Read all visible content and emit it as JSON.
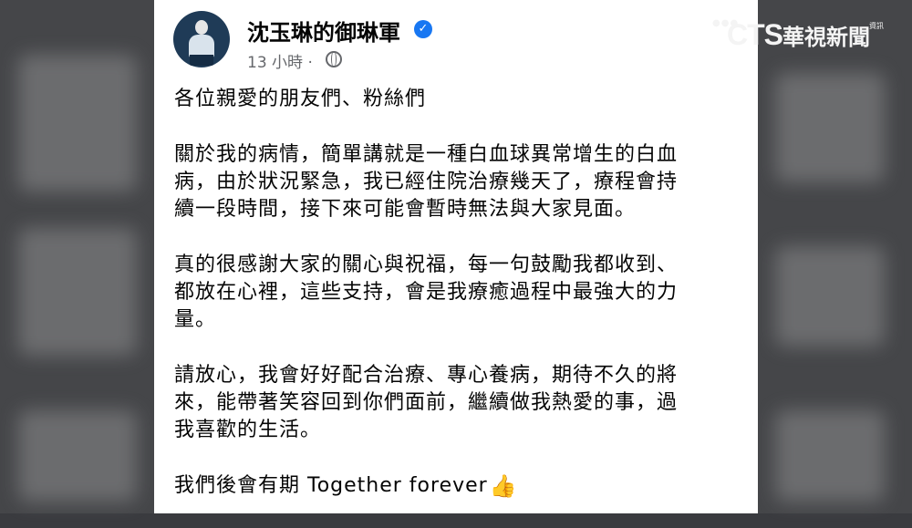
{
  "page": {
    "name": "沈玉琳的御琳軍",
    "time": "13 小時 ·",
    "icons": {
      "verified": "verified-badge-icon",
      "audience": "globe-icon",
      "emoji": "thumbs-up-icon"
    }
  },
  "post": {
    "greeting": "各位親愛的朋友們、粉絲們",
    "p1": [
      "關於我的病情，簡單講就是一種白血球異常增生的白血",
      "病，由於狀況緊急，我已經住院治療幾天了，療程會持",
      "續一段時間，接下來可能會暫時無法與大家見面。"
    ],
    "p2": [
      "真的很感謝大家的關心與祝福，每一句鼓勵我都收到、",
      "都放在心裡，這些支持，會是我療癒過程中最強大的力",
      "量。"
    ],
    "p3": [
      "請放心，我會好好配合治療、專心養病，期待不久的將",
      "來，能帶著笑容回到你們面前，繼續做我熱愛的事，過",
      "我喜歡的生活。"
    ],
    "closing": "我們後會有期  Together forever",
    "emoji": "👍"
  },
  "watermark": {
    "cts": "CTS",
    "chinese": "華視新聞",
    "tiny": "資訊"
  },
  "colors": {
    "card": "#ffffff",
    "text": "#050505",
    "meta": "#65676b",
    "verified": "#1877f2",
    "background": "#454649"
  }
}
